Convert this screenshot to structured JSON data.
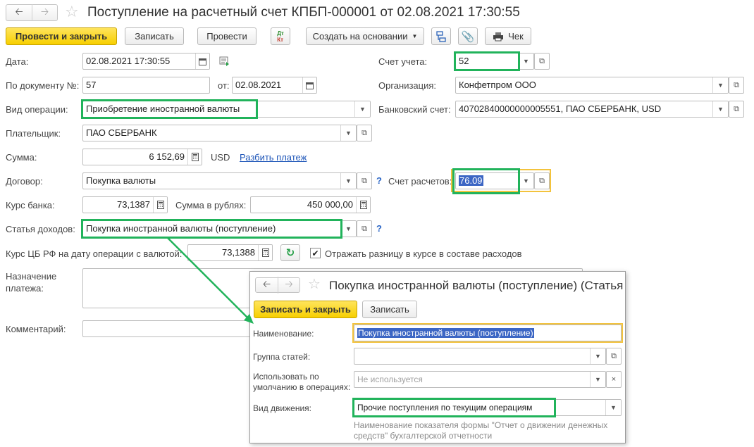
{
  "window": {
    "title": "Поступление на расчетный счет КПБП-000001 от 02.08.2021 17:30:55"
  },
  "toolbar": {
    "post_close": "Провести и закрыть",
    "save": "Записать",
    "post": "Провести",
    "dtkt_top": "Дт",
    "dtkt_bottom": "Кт",
    "create_based": "Создать на основании",
    "check": "Чек"
  },
  "form": {
    "date_label": "Дата:",
    "date_value": "02.08.2021 17:30:55",
    "docnum_label": "По документу №:",
    "docnum_value": "57",
    "from_label": "от:",
    "from_value": "02.08.2021",
    "op_label": "Вид операции:",
    "op_value": "Приобретение иностранной валюты",
    "payer_label": "Плательщик:",
    "payer_value": "ПАО СБЕРБАНК",
    "sum_label": "Сумма:",
    "sum_value": "6 152,69",
    "currency": "USD",
    "split_link": "Разбить платеж",
    "contract_label": "Договор:",
    "contract_value": "Покупка валюты",
    "rate_label": "Курс банка:",
    "rate_value": "73,1387",
    "rub_label": "Сумма в рублях:",
    "rub_value": "450 000,00",
    "income_label": "Статья доходов:",
    "income_value": "Покупка иностранной валюты (поступление)",
    "cbrate_label": "Курс ЦБ РФ на дату операции с валютой:",
    "cbrate_value": "73,1388",
    "diff_checkbox_label": "Отражать разницу в курсе в составе расходов",
    "purpose_label_1": "Назначение",
    "purpose_label_2": "платежа:",
    "comment_label": "Комментарий:",
    "account_label": "Счет учета:",
    "account_value": "52",
    "org_label": "Организация:",
    "org_value": "Конфетпром ООО",
    "bank_label": "Банковский счет:",
    "bank_value": "40702840000000005551, ПАО СБЕРБАНК, USD",
    "settle_label": "Счет расчетов:",
    "settle_value": "76.09",
    "question": "?"
  },
  "popup": {
    "title": "Покупка иностранной валюты (поступление) (Статья",
    "save_close": "Записать и закрыть",
    "save": "Записать",
    "name_label": "Наименование:",
    "name_value": "Покупка иностранной валюты (поступление)",
    "group_label": "Группа статей:",
    "group_value": "",
    "use_label_1": "Использовать по",
    "use_label_2": "умолчанию в операциях:",
    "use_placeholder": "Не используется",
    "move_label": "Вид движения:",
    "move_value": "Прочие поступления по текущим операциям",
    "hint_1": "Наименование показателя формы \"Отчет о движении денежных",
    "hint_2": "средств\" бухгалтерской отчетности"
  },
  "colors": {
    "highlight_green": "#21b35b",
    "highlight_yellow": "#f3c33d",
    "primary_button": "#f7cf00",
    "link": "#1d55b8",
    "selection": "#3c66c4"
  }
}
